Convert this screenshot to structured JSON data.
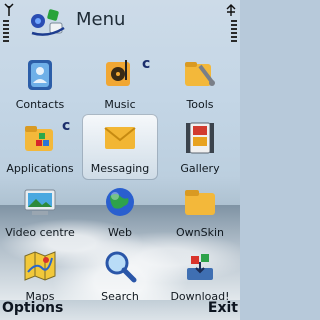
{
  "titlebar": {
    "title": "Menu"
  },
  "grid": [
    {
      "label": "Contacts",
      "icon": "contacts-icon"
    },
    {
      "label": "Music",
      "icon": "music-icon"
    },
    {
      "label": "Tools",
      "icon": "tools-icon"
    },
    {
      "label": "Applications",
      "icon": "applications-icon"
    },
    {
      "label": "Messaging",
      "icon": "messaging-icon"
    },
    {
      "label": "Gallery",
      "icon": "gallery-icon"
    },
    {
      "label": "Video centre",
      "icon": "video-centre-icon"
    },
    {
      "label": "Web",
      "icon": "web-icon"
    },
    {
      "label": "OwnSkin",
      "icon": "ownskin-icon"
    },
    {
      "label": "Maps",
      "icon": "maps-icon"
    },
    {
      "label": "Search",
      "icon": "search-icon"
    },
    {
      "label": "Download!",
      "icon": "download-icon"
    }
  ],
  "softkeys": {
    "left": "Options",
    "right": "Exit"
  },
  "colors": {
    "accent_selected": "#f0f4f8",
    "text": "#10181f"
  }
}
